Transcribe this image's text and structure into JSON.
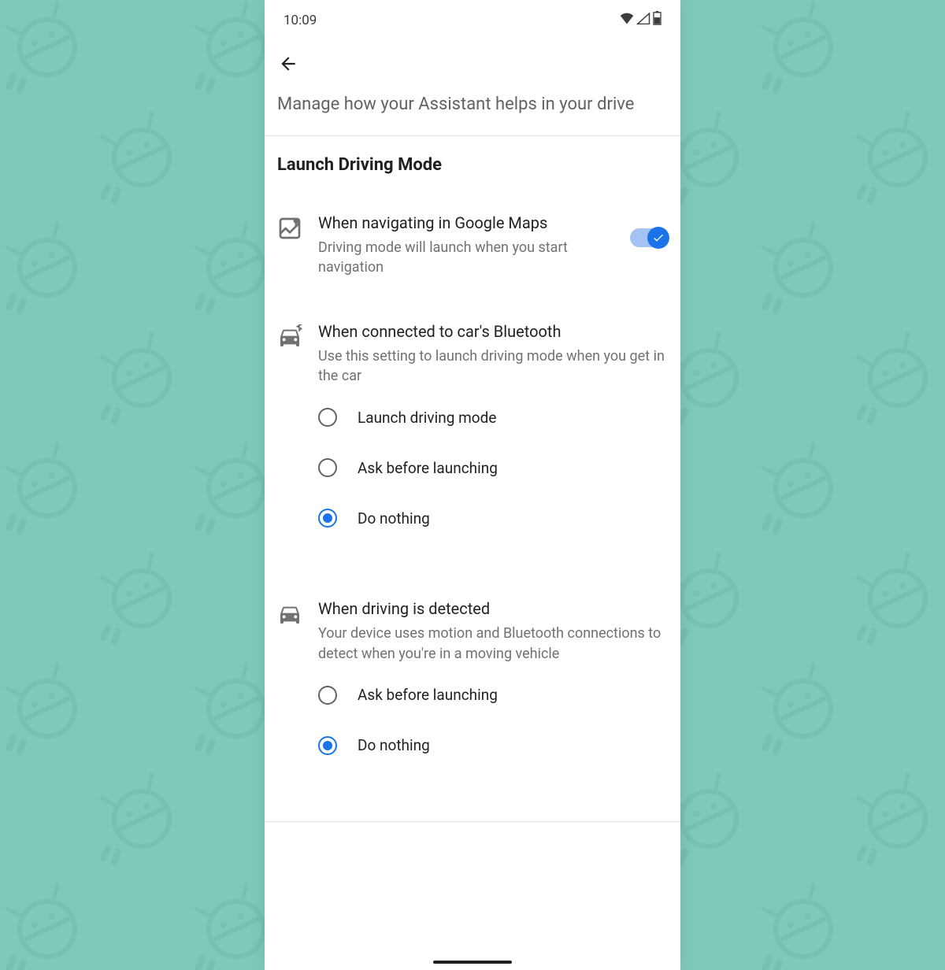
{
  "status_bar": {
    "time": "10:09",
    "wifi_icon": "wifi",
    "signal_icon": "signal",
    "battery_icon": "battery"
  },
  "header": {
    "subtitle": "Manage how your Assistant helps in your drive"
  },
  "section": {
    "title": "Launch Driving Mode"
  },
  "settings": {
    "maps": {
      "title": "When navigating in Google Maps",
      "desc": "Driving mode will launch when you start navigation",
      "enabled": true
    },
    "bluetooth": {
      "title": "When connected to car's Bluetooth",
      "desc": "Use this setting to launch driving mode when you get in the car",
      "options": [
        {
          "label": "Launch driving mode",
          "selected": false
        },
        {
          "label": "Ask before launching",
          "selected": false
        },
        {
          "label": "Do nothing",
          "selected": true
        }
      ]
    },
    "detected": {
      "title": "When driving is detected",
      "desc": "Your device uses motion and Bluetooth connections to detect when you're in a moving vehicle",
      "options": [
        {
          "label": "Ask before launching",
          "selected": false
        },
        {
          "label": "Do nothing",
          "selected": true
        }
      ]
    }
  }
}
